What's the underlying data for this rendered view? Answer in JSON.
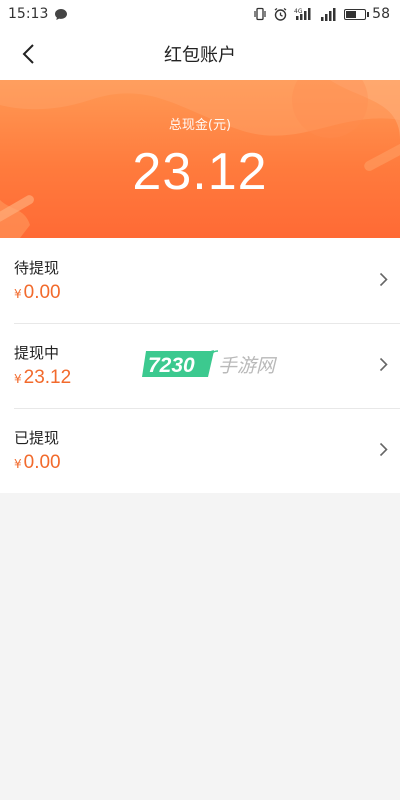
{
  "status_bar": {
    "time": "15:13",
    "network_label": "4G",
    "battery": "58",
    "battery_level": 0.58
  },
  "nav": {
    "title": "红包账户"
  },
  "summary": {
    "label": "总现金(元)",
    "amount": "23.12"
  },
  "accounts": [
    {
      "title": "待提现",
      "currency": "¥",
      "amount": "0.00"
    },
    {
      "title": "提现中",
      "currency": "¥",
      "amount": "23.12"
    },
    {
      "title": "已提现",
      "currency": "¥",
      "amount": "0.00"
    }
  ],
  "watermark": {
    "number": "7230",
    "text": "手游网"
  },
  "colors": {
    "accent": "#f26a2c",
    "banner_top": "#ff9a55",
    "banner_bottom": "#ff6a35",
    "watermark_green": "#3cc98f"
  }
}
